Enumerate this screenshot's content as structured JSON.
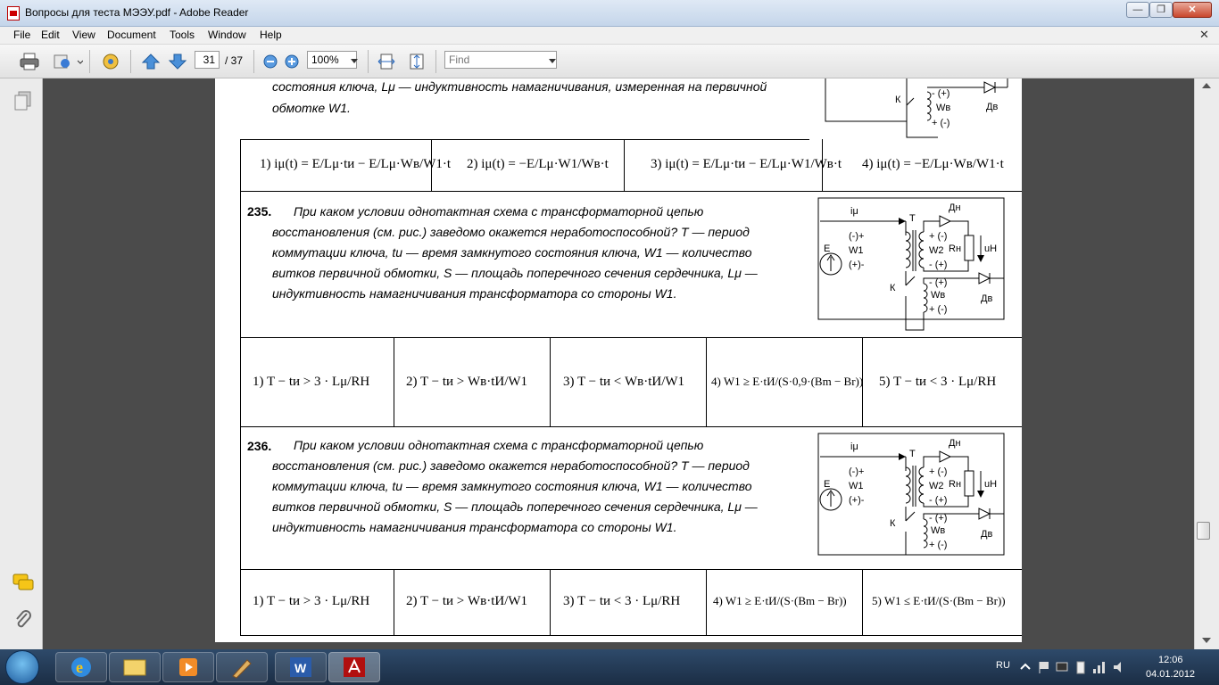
{
  "window": {
    "title": "Вопросы для теста МЭЭУ.pdf - Adobe Reader"
  },
  "menu": [
    "File",
    "Edit",
    "View",
    "Document",
    "Tools",
    "Window",
    "Help"
  ],
  "toolbar": {
    "page_current": "31",
    "page_total": "/ 37",
    "zoom": "100%",
    "find_placeholder": "Find"
  },
  "q234": {
    "text_lines": [
      "состояния ключа, Lμ — индуктивность намагничивания, измеренная на первичной",
      "обмотке W1."
    ],
    "answers": [
      "1) iμ(t) = E/Lμ·tи − E/Lμ·Wв/W1·t",
      "2) iμ(t) = −E/Lμ·W1/Wв·t",
      "3) iμ(t) = E/Lμ·tи − E/Lμ·W1/Wв·t",
      "4) iμ(t) = −E/Lμ·Wв/W1·t"
    ]
  },
  "q235": {
    "number": "235.",
    "text_lines": [
      "При каком условии однотактная схема с трансформаторной цепью",
      "восстановления (см. рис.) заведомо окажется неработоспособной? T — период",
      "коммутации ключа, tи — время замкнутого состояния ключа, W1 — количество",
      "витков первичной обмотки, S — площадь поперечного сечения сердечника, Lμ —",
      "индуктивность намагничивания трансформатора со стороны W1."
    ],
    "answers": [
      "1) T − tи > 3 · Lμ/RH",
      "2) T − tи > Wв·tИ/W1",
      "3) T − tи < Wв·tИ/W1",
      "4) W1 ≥ E·tИ/(S·0,9·(Bm − Br))",
      "5) T − tи < 3 · Lμ/RH"
    ]
  },
  "q236": {
    "number": "236.",
    "text_lines": [
      "При каком условии однотактная схема с трансформаторной цепью",
      "восстановления (см. рис.) заведомо окажется неработоспособной? T — период",
      "коммутации ключа, tи — время замкнутого состояния ключа, W1 — количество",
      "витков первичной обмотки, S — площадь поперечного сечения сердечника, Lμ —",
      "индуктивность намагничивания трансформатора со стороны W1."
    ],
    "answers": [
      "1) T − tи > 3 · Lμ/RH",
      "2) T − tи > Wв·tИ/W1",
      "3) T − tи < 3 · Lμ/RH",
      "4) W1 ≥ E·tИ/(S·(Bm − Br))",
      "5) W1 ≤ E·tИ/(S·(Bm − Br))"
    ]
  },
  "circuit_labels": {
    "T": "T",
    "E": "E",
    "W1": "W1",
    "W2": "W2",
    "Wv": "Wв",
    "K": "К",
    "Dn": "Дн",
    "Dv": "Дв",
    "Rn": "Rн",
    "uH": "uH",
    "imu": "iμ",
    "pm1": "(-)+",
    "pm2": "(+)-",
    "p3": "+ (-)",
    "p4": "- (+)"
  },
  "taskbar": {
    "lang": "RU",
    "time": "12:06",
    "date": "04.01.2012"
  }
}
